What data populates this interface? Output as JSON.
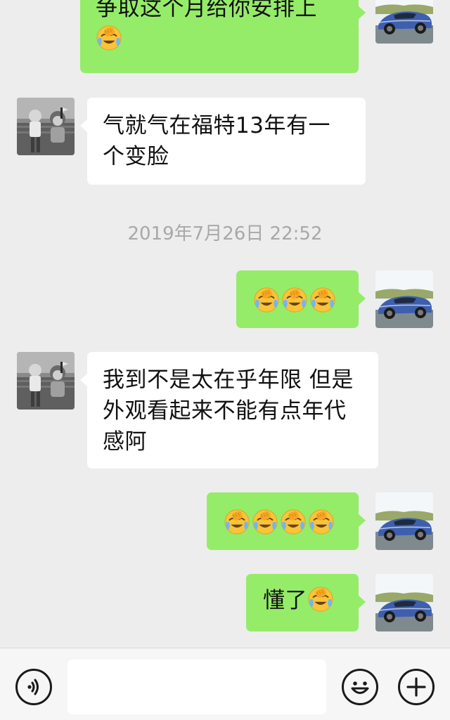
{
  "messages": [
    {
      "id": "m1",
      "side": "me",
      "text": "争取这个月给你安排上",
      "emoji_count": 1
    },
    {
      "id": "m2",
      "side": "contact",
      "text": "气就气在福特13年有一个变脸",
      "emoji_count": 0
    },
    {
      "id": "m3",
      "side": "me",
      "text": "",
      "emoji_count": 3
    },
    {
      "id": "m4",
      "side": "contact",
      "text": "我到不是太在乎年限  但是外观看起来不能有点年代感阿",
      "emoji_count": 0
    },
    {
      "id": "m5",
      "side": "me",
      "text": "",
      "emoji_count": 4
    },
    {
      "id": "m6",
      "side": "me",
      "text": "懂了",
      "emoji_count": 1
    }
  ],
  "timestamp": "2019年7月26日 22:52",
  "emoji_name": "face-palm-crying-emoji",
  "input": {
    "value": "",
    "placeholder": ""
  },
  "icons": {
    "voice": "voice-icon",
    "emoji": "smiley-icon",
    "more": "plus-icon"
  },
  "colors": {
    "background": "#ededed",
    "my_bubble": "#95ec69",
    "their_bubble": "#ffffff",
    "timestamp": "#a8a8a8",
    "input_bar": "#f6f6f6"
  }
}
